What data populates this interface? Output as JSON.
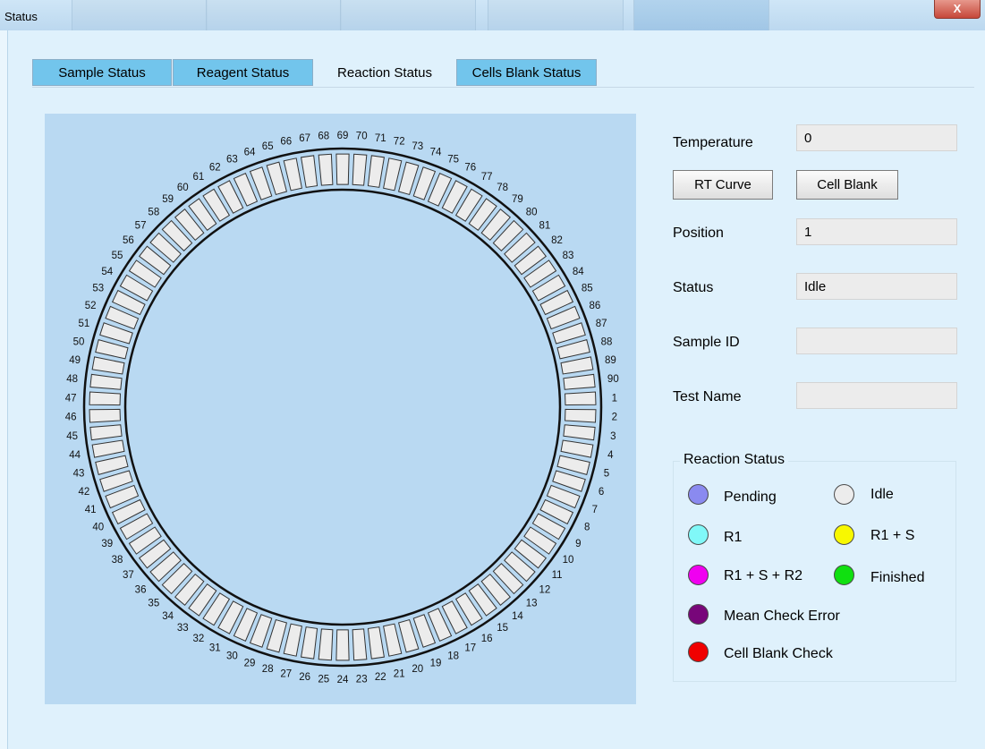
{
  "window": {
    "title": "Status",
    "close_label": "X"
  },
  "colors": {
    "pending": "#8a8af0",
    "idle": "#ececec",
    "r1": "#80f8f8",
    "r1_s": "#f8f800",
    "r1_s_r2": "#f000f0",
    "finished": "#10e010",
    "mean_check_error": "#78067a",
    "cell_blank_check": "#f00000"
  },
  "tabs": [
    "Sample Status",
    "Reagent Status",
    "Reaction Status",
    "Cells Blank Status"
  ],
  "active_tab": "Reaction Status",
  "reaction_plate": {
    "positions": 90,
    "labels": [
      "1",
      "2",
      "3",
      "4",
      "5",
      "6",
      "7",
      "8",
      "9",
      "10",
      "11",
      "12",
      "13",
      "14",
      "15",
      "16",
      "17",
      "18",
      "19",
      "20",
      "21",
      "22",
      "23",
      "24",
      "25",
      "26",
      "27",
      "28",
      "29",
      "30",
      "31",
      "32",
      "33",
      "34",
      "35",
      "36",
      "37",
      "38",
      "39",
      "40",
      "41",
      "42",
      "43",
      "44",
      "45",
      "46",
      "47",
      "48",
      "49",
      "50",
      "51",
      "52",
      "53",
      "54",
      "55",
      "56",
      "57",
      "58",
      "59",
      "60",
      "61",
      "62",
      "63",
      "64",
      "65",
      "66",
      "67",
      "68",
      "69",
      "70",
      "71",
      "72",
      "73",
      "74",
      "75",
      "76",
      "77",
      "78",
      "79",
      "80",
      "81",
      "82",
      "83",
      "84",
      "85",
      "86",
      "87",
      "88",
      "89",
      "90"
    ]
  },
  "details": {
    "temperature_label": "Temperature",
    "temperature_value": "0",
    "rt_curve_button": "RT Curve",
    "cell_blank_button": "Cell Blank",
    "position_label": "Position",
    "position_value": "1",
    "status_label": "Status",
    "status_value": "Idle",
    "sample_id_label": "Sample ID",
    "sample_id_value": "",
    "test_name_label": "Test Name",
    "test_name_value": ""
  },
  "legend": {
    "title": "Reaction Status",
    "pending": "Pending",
    "idle": "Idle",
    "r1": "R1",
    "r1_s": "R1 + S",
    "r1_s_r2": "R1 + S + R2",
    "finished": "Finished",
    "mean_check_error": "Mean Check Error",
    "cell_blank_check": "Cell Blank Check"
  }
}
